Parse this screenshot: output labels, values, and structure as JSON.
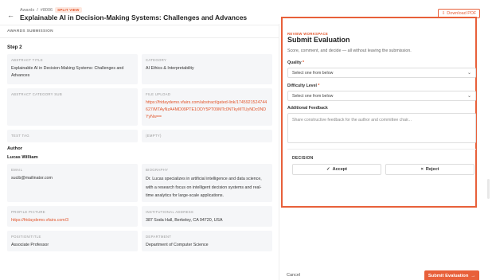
{
  "header": {
    "breadcrumb_parent": "Awards",
    "breadcrumb_id": "#8006",
    "badge": "SPLIT VIEW",
    "title": "Explainable AI in Decision-Making Systems: Challenges and Advances",
    "download_label": "Download PDF"
  },
  "submission": {
    "section_label": "AWARDS SUBMISSION",
    "step": "Step 2",
    "fields": {
      "abstract_title": {
        "label": "ABSTRACT TITLE",
        "value": "Explainable AI in Decision-Making Systems: Challenges and Advances"
      },
      "category": {
        "label": "CATEGORY",
        "value": "AI Ethics & Interpretability"
      },
      "abstract_category_sub": {
        "label": "ABSTRACT CATEGORY SUB",
        "value": ""
      },
      "file_upload": {
        "label": "FILE UPLOAD",
        "value": "https://fridaydemo.vfairs.com/abstract/gated-link/1745921524744627/MTAyNzA4MD09PTE1ODY5PT09MTc0NTkyMTUyNDc0NDYyNw=="
      },
      "test_tag": {
        "label": "TEST TAG",
        "value": ""
      },
      "empty": {
        "label": "(EMPTY)",
        "value": ""
      }
    },
    "author": {
      "heading": "Author",
      "name": "Lucas William",
      "email": {
        "label": "EMAIL",
        "value": "sucib@mailinator.com"
      },
      "biography": {
        "label": "BIOGRAPHY",
        "value": "Dr. Lucas specializes in artificial intelligence and data science, with a research focus on intelligent decision systems and real-time analytics for large-scale applications."
      },
      "profile_picture": {
        "label": "PROFILE PICTURE",
        "value": "https://fridaydemo.vfairs.com/3"
      },
      "institutional_address": {
        "label": "INSTITUTIONAL ADDRESS",
        "value": "387 Soda Hall, Berkeley, CA 94720, USA"
      },
      "position": {
        "label": "POSITION/TITLE",
        "value": "Associate Professor"
      },
      "department": {
        "label": "DEPARTMENT",
        "value": "Department of Computer Science"
      }
    }
  },
  "review": {
    "eyebrow": "REVIEW WORKSPACE",
    "title": "Submit Evaluation",
    "subtitle": "Score, comment, and decide — all without leaving the submission.",
    "quality_label": "Quality",
    "quality_value": "Select one from below",
    "difficulty_label": "Difficulty Level",
    "difficulty_value": "Select one from below",
    "feedback_label": "Additional Feedback",
    "feedback_placeholder": "Share constructive feedback for the author and committee chair...",
    "decision_label": "DECISION",
    "accept_label": "Accept",
    "reject_label": "Reject"
  },
  "footer": {
    "cancel_label": "Cancel",
    "submit_label": "Submit Evaluation"
  },
  "colors": {
    "accent": "#e8603a"
  }
}
